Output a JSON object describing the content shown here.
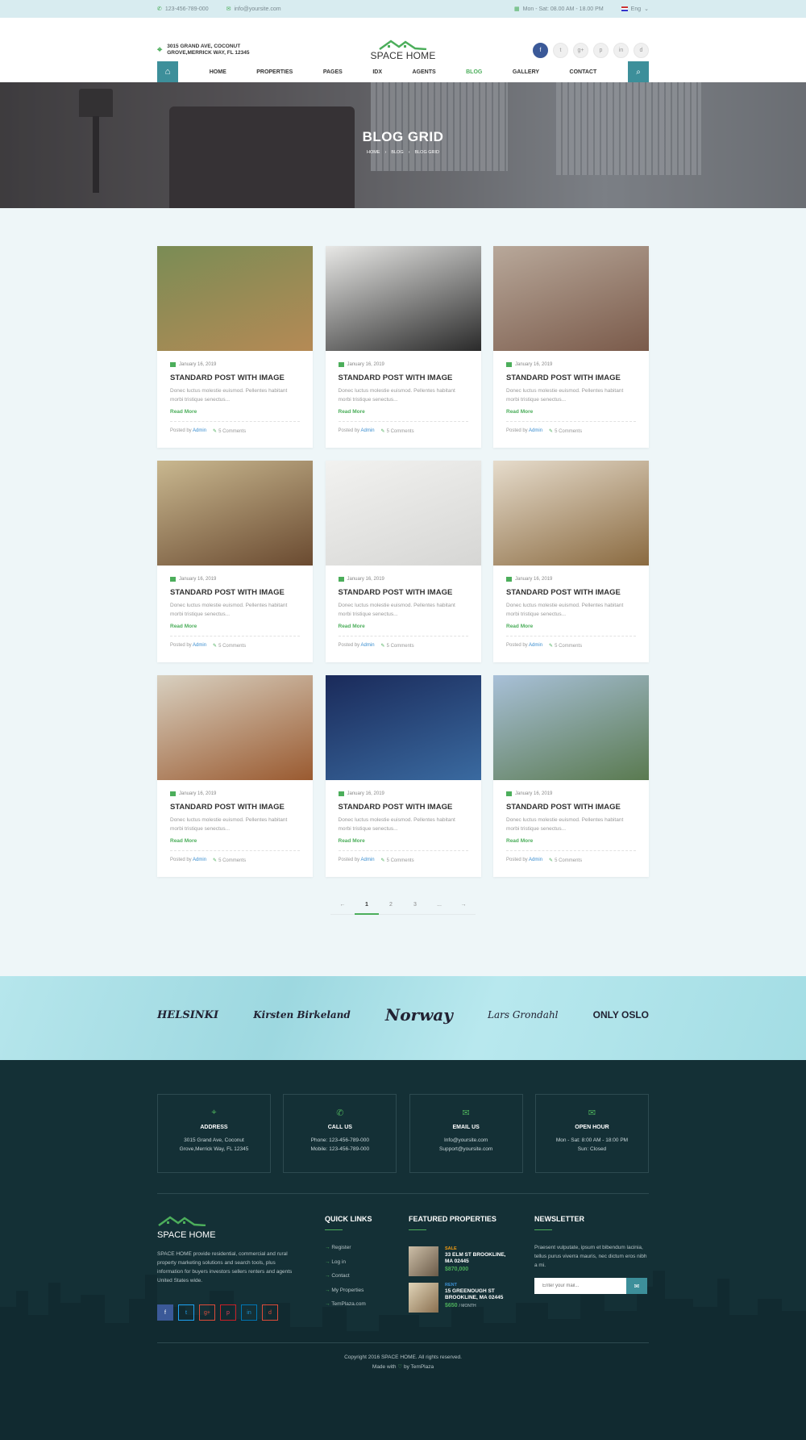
{
  "topbar": {
    "phone": "123-456-789-000",
    "email": "info@yoursite.com",
    "hours": "Mon - Sat: 08.00 AM - 18.00 PM",
    "language": "Eng"
  },
  "header": {
    "address_line1": "3015 GRAND AVE, COCONUT",
    "address_line2": "GROVE,MERRICK WAY, FL 12345",
    "logo_text": "SPACE HOME",
    "socials": [
      "f",
      "t",
      "g+",
      "p",
      "in",
      "d"
    ]
  },
  "nav": {
    "items": [
      "HOME",
      "PROPERTIES",
      "PAGES",
      "IDX",
      "AGENTS",
      "BLOG",
      "GALLERY",
      "CONTACT"
    ],
    "active": "BLOG"
  },
  "hero": {
    "title": "BLOG GRID",
    "breadcrumb": [
      "HOME",
      "BLOG",
      "BLOG GRID"
    ]
  },
  "posts": [
    {
      "date": "January 16, 2019",
      "title": "STANDARD POST WITH IMAGE",
      "excerpt": "Donec luctus molestie euismod. Pellentes habitant morbi tristique senectus...",
      "read_more": "Read More",
      "posted_by": "Posted by",
      "author": "Admin",
      "comments": "5 Comments",
      "img_colors": [
        "#7a8c55",
        "#b58a55"
      ]
    },
    {
      "date": "January 16, 2019",
      "title": "STANDARD POST WITH IMAGE",
      "excerpt": "Donec luctus molestie euismod. Pellentes habitant morbi tristique senectus...",
      "read_more": "Read More",
      "posted_by": "Posted by",
      "author": "Admin",
      "comments": "5 Comments",
      "img_colors": [
        "#e8e8e6",
        "#2a2a2a"
      ]
    },
    {
      "date": "January 16, 2019",
      "title": "STANDARD POST WITH IMAGE",
      "excerpt": "Donec luctus molestie euismod. Pellentes habitant morbi tristique senectus...",
      "read_more": "Read More",
      "posted_by": "Posted by",
      "author": "Admin",
      "comments": "5 Comments",
      "img_colors": [
        "#b8a89a",
        "#7a5a4a"
      ]
    },
    {
      "date": "January 16, 2019",
      "title": "STANDARD POST WITH IMAGE",
      "excerpt": "Donec luctus molestie euismod. Pellentes habitant morbi tristique senectus...",
      "read_more": "Read More",
      "posted_by": "Posted by",
      "author": "Admin",
      "comments": "5 Comments",
      "img_colors": [
        "#c9b890",
        "#6a4a30"
      ]
    },
    {
      "date": "January 16, 2019",
      "title": "STANDARD POST WITH IMAGE",
      "excerpt": "Donec luctus molestie euismod. Pellentes habitant morbi tristique senectus...",
      "read_more": "Read More",
      "posted_by": "Posted by",
      "author": "Admin",
      "comments": "5 Comments",
      "img_colors": [
        "#f2f2f0",
        "#d6d6d4"
      ]
    },
    {
      "date": "January 16, 2019",
      "title": "STANDARD POST WITH IMAGE",
      "excerpt": "Donec luctus molestie euismod. Pellentes habitant morbi tristique senectus...",
      "read_more": "Read More",
      "posted_by": "Posted by",
      "author": "Admin",
      "comments": "5 Comments",
      "img_colors": [
        "#e6dccc",
        "#8a6a40"
      ]
    },
    {
      "date": "January 16, 2019",
      "title": "STANDARD POST WITH IMAGE",
      "excerpt": "Donec luctus molestie euismod. Pellentes habitant morbi tristique senectus...",
      "read_more": "Read More",
      "posted_by": "Posted by",
      "author": "Admin",
      "comments": "5 Comments",
      "img_colors": [
        "#d8d0c0",
        "#9a5a30"
      ]
    },
    {
      "date": "January 16, 2019",
      "title": "STANDARD POST WITH IMAGE",
      "excerpt": "Donec luctus molestie euismod. Pellentes habitant morbi tristique senectus...",
      "read_more": "Read More",
      "posted_by": "Posted by",
      "author": "Admin",
      "comments": "5 Comments",
      "img_colors": [
        "#1a2a5a",
        "#3a6aa0"
      ]
    },
    {
      "date": "January 16, 2019",
      "title": "STANDARD POST WITH IMAGE",
      "excerpt": "Donec luctus molestie euismod. Pellentes habitant morbi tristique senectus...",
      "read_more": "Read More",
      "posted_by": "Posted by",
      "author": "Admin",
      "comments": "5 Comments",
      "img_colors": [
        "#a8c0d8",
        "#5a7a50"
      ]
    }
  ],
  "pagination": {
    "prev": "←",
    "pages": [
      "1",
      "2",
      "3",
      "..."
    ],
    "next": "→",
    "active": "1"
  },
  "partners": [
    "HELSINKI",
    "Kirsten Birkeland",
    "Norway",
    "Lars Grondahl",
    "ONLY OSLO"
  ],
  "contact": [
    {
      "icon": "location-icon",
      "title": "ADDRESS",
      "line1": "3015 Grand Ave, Coconut",
      "line2": "Grove,Merrick Way, FL 12345"
    },
    {
      "icon": "phone-icon",
      "title": "CALL US",
      "line1": "Phone: 123-456-789-000",
      "line2": "Mobile: 123-456-789-000"
    },
    {
      "icon": "email-icon",
      "title": "EMAIL US",
      "line1": "Info@yoursite.com",
      "line2": "Support@yoursite.com"
    },
    {
      "icon": "clock-icon",
      "title": "OPEN HOUR",
      "line1": "Mon - Sat: 8:00 AM - 18:00 PM",
      "line2": "Sun: Closed"
    }
  ],
  "footer": {
    "logo_text": "SPACE HOME",
    "description": "SPACE HOME provide residential, commercial and rural property  marketing solutions and search tools, plus information for buyers investors sellers renters and agents United States wide.",
    "socials": [
      "f",
      "t",
      "g+",
      "p",
      "in",
      "d"
    ],
    "social_colors": [
      "#3b5998",
      "#1da1f2",
      "#dd4b39",
      "#cb2027",
      "#0077b5",
      "#dd4b39"
    ],
    "quick_links_title": "QUICK LINKS",
    "quick_links": [
      "Register",
      "Log in",
      "Contact",
      "My Properties",
      "TemPlaza.com"
    ],
    "featured_title": "FEATURED PROPERTIES",
    "featured": [
      {
        "tag": "SALE",
        "tag_color": "#f39c12",
        "address1": "33 ELM ST BROOKLINE,",
        "address2": "MA 02445",
        "price": "$870,000",
        "unit": ""
      },
      {
        "tag": "RENT",
        "tag_color": "#3b8ed0",
        "address1": "15 GREENOUGH ST",
        "address2": "BROOKLINE, MA 02445",
        "price": "$650",
        "unit": "/ MONTH"
      }
    ],
    "newsletter_title": "NEWSLETTER",
    "newsletter_desc": "Praesent vulputate, ipsum et bibendum lacinia, tellus purus viverra mauris, nec dictum eros nibh a mi.",
    "newsletter_placeholder": "Enter your mail...",
    "copyright": "Copyright 2016 SPACE HOME. All rights reserved.",
    "made_with_prefix": "Made with",
    "made_with_suffix": "by TemPlaza"
  },
  "colors": {
    "accent_green": "#4cae5b",
    "accent_teal": "#3d8f9a",
    "footer_bg": "#143036"
  }
}
